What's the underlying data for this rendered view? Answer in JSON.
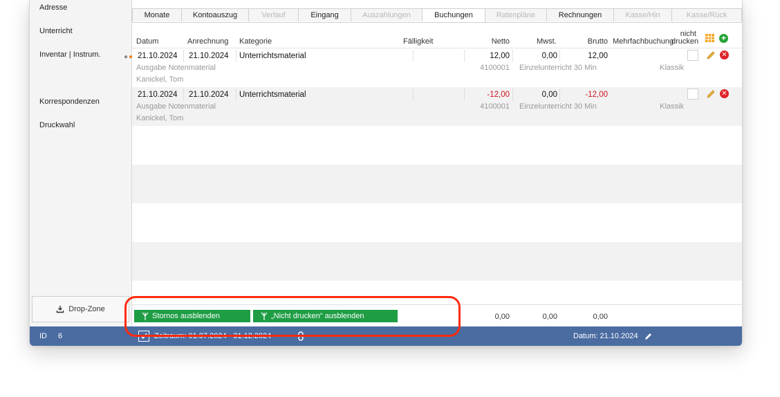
{
  "sidebar": {
    "items": [
      "Adresse",
      "Unterricht",
      "Inventar | Instrum.",
      "Korrespondenzen",
      "Druckwahl"
    ],
    "dropzone_label": "Drop-Zone"
  },
  "tabs": [
    {
      "label": "Monate",
      "state": "normal"
    },
    {
      "label": "Kontoauszug",
      "state": "normal"
    },
    {
      "label": "Verlauf",
      "state": "disabled"
    },
    {
      "label": "Eingang",
      "state": "normal"
    },
    {
      "label": "Auszahlungen",
      "state": "disabled"
    },
    {
      "label": "Buchungen",
      "state": "active"
    },
    {
      "label": "Ratenpläne",
      "state": "disabled"
    },
    {
      "label": "Rechnungen",
      "state": "normal"
    },
    {
      "label": "Kasse/Hin",
      "state": "disabled"
    },
    {
      "label": "Kasse/Rück",
      "state": "disabled"
    }
  ],
  "table": {
    "headers": {
      "datum": "Datum",
      "anrechnung": "Anrechnung",
      "kategorie": "Kategorie",
      "faelligkeit": "Fälligkeit",
      "netto": "Netto",
      "mwst": "Mwst.",
      "brutto": "Brutto",
      "mehrfach": "Mehrfachbuchung",
      "nicht_drucken_1": "nicht",
      "nicht_drucken_2": "drucken"
    },
    "rows": [
      {
        "datum": "21.10.2024",
        "anrechnung": "21.10.2024",
        "kategorie": "Unterrichtsmaterial",
        "netto": "12,00",
        "mwst": "0,00",
        "brutto": "12,00",
        "beschreibung": "Ausgabe Notenmaterial",
        "konto": "4100001",
        "leistung": "Einzelunterricht 30 Min",
        "fach": "Klassik",
        "person": "Kanickel, Tom",
        "negative": false
      },
      {
        "datum": "21.10.2024",
        "anrechnung": "21.10.2024",
        "kategorie": "Unterrichtsmaterial",
        "netto": "-12,00",
        "mwst": "0,00",
        "brutto": "-12,00",
        "beschreibung": "Ausgabe Notenmaterial",
        "konto": "4100001",
        "leistung": "Einzelunterricht 30 Min",
        "fach": "Klassik",
        "person": "Kanickel, Tom",
        "negative": true
      }
    ]
  },
  "footer": {
    "btn_stornos": "Stornos ausblenden",
    "btn_nicht_drucken": "„Nicht drucken“ ausblenden",
    "total_netto": "0,00",
    "total_mwst": "0,00",
    "total_brutto": "0,00"
  },
  "statusbar": {
    "id_label": "ID",
    "id_value": "6",
    "zeitraum": "Zeitraum:  01.07.2024 - 31.12.2024",
    "datum": "Datum: 21.10.2024"
  },
  "colors": {
    "statusbar": "#4a6ca1",
    "button_green": "#1f9d45",
    "negative_amount": "#d0121b",
    "highlight": "#ff2a0e"
  }
}
